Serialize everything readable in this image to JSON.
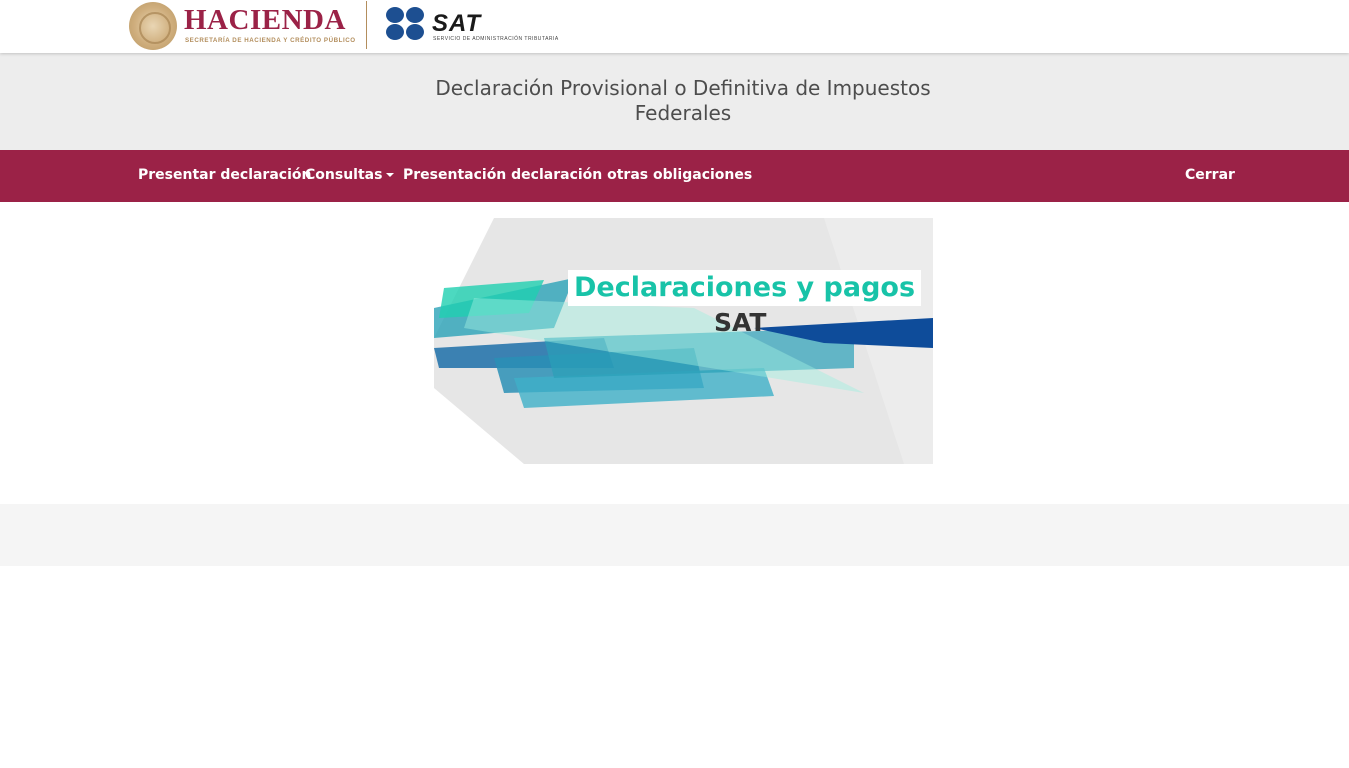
{
  "header": {
    "hacienda_title": "HACIENDA",
    "hacienda_subtitle": "SECRETARÍA DE HACIENDA Y CRÉDITO PÚBLICO",
    "sat_title": "SAT",
    "sat_subtitle": "SERVICIO DE ADMINISTRACIÓN TRIBUTARIA"
  },
  "page": {
    "title_line1": "Declaración Provisional o Definitiva de Impuestos",
    "title_line2": "Federales"
  },
  "nav": {
    "presentar": "Presentar declaración",
    "consultas": "Consultas",
    "otras": "Presentación declaración otras obligaciones",
    "cerrar": "Cerrar"
  },
  "banner": {
    "line1": "Declaraciones y pagos",
    "line2": "SAT"
  },
  "colors": {
    "brand_primary": "#9b2247",
    "brand_gold": "#b38e5d",
    "sat_blue": "#1d4f91",
    "banner_teal": "#18c3a8"
  }
}
